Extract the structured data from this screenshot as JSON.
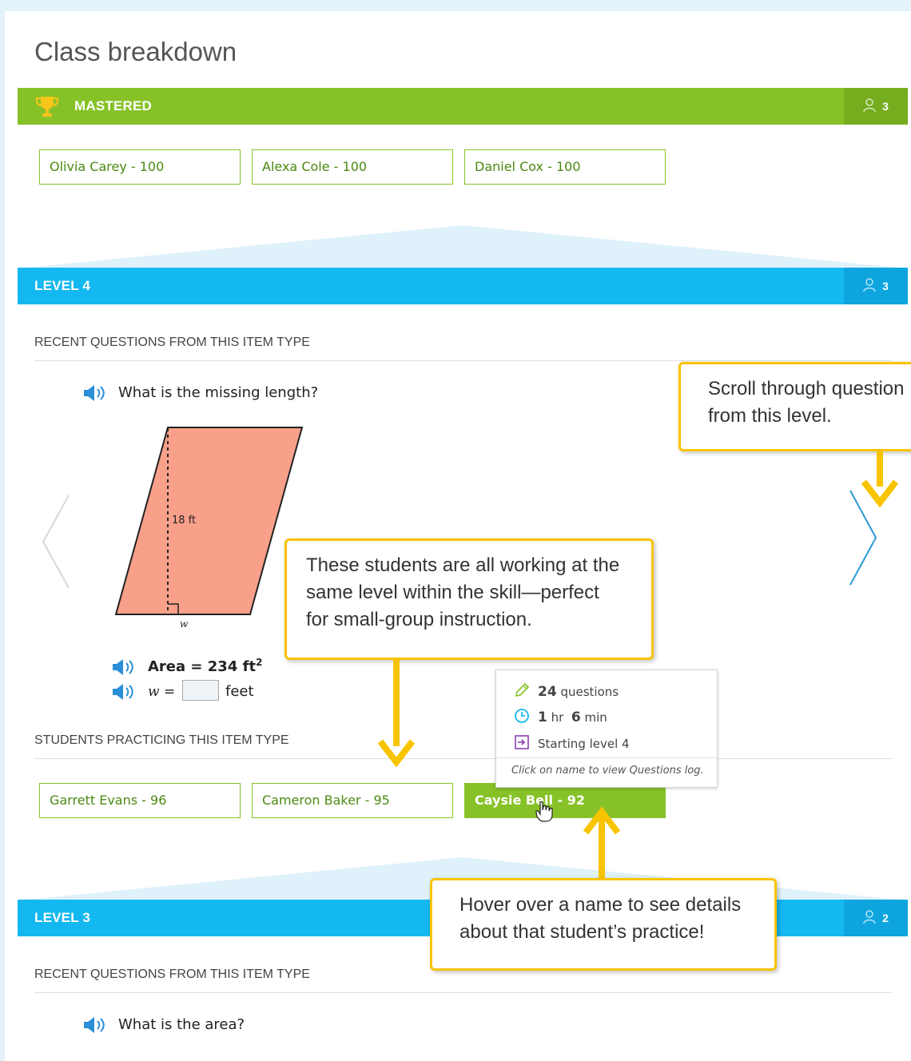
{
  "page": {
    "title": "Class breakdown"
  },
  "mastered": {
    "label": "MASTERED",
    "count": "3",
    "students": [
      "Olivia Carey - 100",
      "Alexa Cole - 100",
      "Daniel Cox - 100"
    ]
  },
  "level4": {
    "label": "LEVEL 4",
    "count": "3",
    "recent_heading": "RECENT QUESTIONS FROM THIS ITEM TYPE",
    "question": "What is the missing length?",
    "figure": {
      "height_label": "18 ft",
      "base_label": "w"
    },
    "area_label": "Area = 234 ft",
    "area_exp": "2",
    "w_label": "w =",
    "unit": "feet",
    "practicing_heading": "STUDENTS PRACTICING THIS ITEM TYPE",
    "students": [
      "Garrett Evans - 96",
      "Cameron Baker - 95",
      "Caysie Bell - 92"
    ]
  },
  "tooltip": {
    "questions_num": "24",
    "questions_label": "questions",
    "hours_num": "1",
    "hours_label": "hr",
    "mins_num": "6",
    "mins_label": "min",
    "starting": "Starting level 4",
    "note": "Click on name to view Questions log."
  },
  "level3": {
    "label": "LEVEL 3",
    "count": "2",
    "recent_heading": "RECENT QUESTIONS FROM THIS ITEM TYPE",
    "question": "What is the area?"
  },
  "callouts": {
    "scroll": [
      "Scroll through question",
      "from this level."
    ],
    "students": [
      "These students are all working at the",
      "same level within the skill—perfect",
      "for small-group instruction."
    ],
    "hover": [
      "Hover over a name to see details",
      "about that student’s practice!"
    ]
  },
  "colors": {
    "green": "#86c227",
    "blue": "#14b8f0",
    "callout": "#f8c400",
    "figure": "#f9a08a"
  },
  "icons": [
    "trophy-icon",
    "person-icon",
    "speaker-icon",
    "pencil-icon",
    "clock-icon",
    "enter-icon",
    "pointer-hand-icon",
    "chevron-left-icon",
    "chevron-right-icon"
  ]
}
